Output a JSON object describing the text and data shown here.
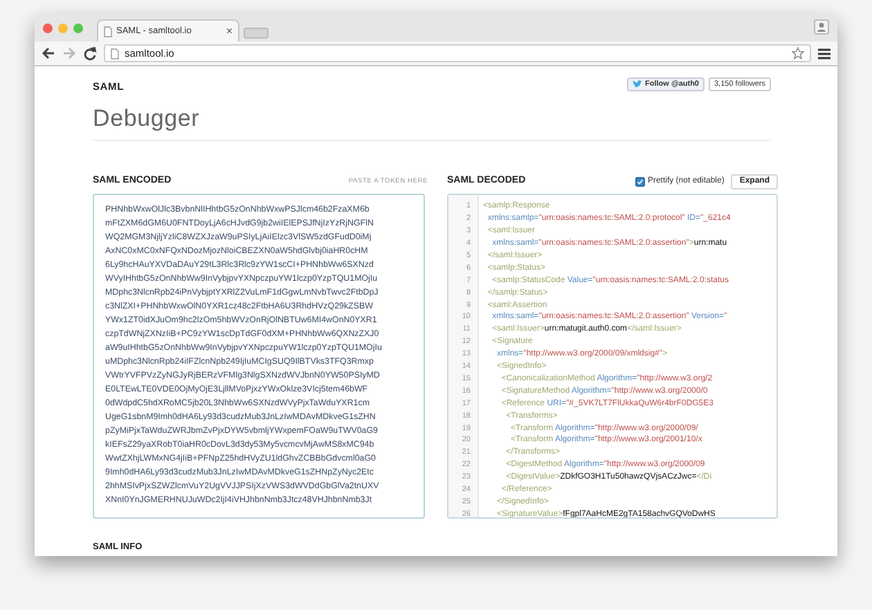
{
  "browser": {
    "tab": {
      "title": "SAML - samltool.io",
      "close": "×"
    },
    "address": "samltool.io"
  },
  "header": {
    "section": "SAML",
    "title": "Debugger",
    "follow_button": "Follow @auth0",
    "followers": "3,150 followers"
  },
  "encoded": {
    "title": "SAML ENCODED",
    "hint": "PASTE A TOKEN HERE",
    "lines": [
      "PHNhbWxwOlJlc3BvbnNlIHhtbG5zOnNhbWxwPSJlcm46b2FzaXM6b",
      "mFtZXM6dGM6U0FNTDoyLjA6cHJvdG9jb2wiIElEPSJfNjIzYzRjNGFlN",
      "WQ2MGM3NjljYzliC8WZXJzaW9uPSIyLjAiIElzc3VlSW5zdGFudD0iMj",
      "AxNC0xMC0xNFQxNDozMjozNloiCBEZXN0aW5hdGlvbj0iaHR0cHM",
      "6Ly9hcHAuYXVDaDAuY29tL3Rlc3Rlc9zYW1scCI+PHNhbWw6SXNzd",
      "WVyIHhtbG5zOnNhbWw9InVybjpvYXNpczpuYW1lczp0YzpTQU1MOjIu",
      "MDphc3NlcnRpb24iPnVybjptYXRlZ2VuLmF1dGgwLmNvbTwvc2FtbDpJ",
      "c3NlZXI+PHNhbWxwOlN0YXR1cz48c2FtbHA6U3RhdHVzQ29kZSBW",
      "YWx1ZT0idXJuOm9hc2lzOm5hbWVzOnRjOlNBTUw6MI4wOnN0YXR1",
      "czpTdWNjZXNzIiB+PC9zYW1scDpTdGF0dXM+PHNhbWw6QXNzZXJ0",
      "aW9uIHhtbG5zOnNhbWw9InVybjpvYXNpczpuYW1lczp0YzpTQU1MOjIu",
      "uMDphc3NlcnRpb24iIFZlcnNpb249IjIuMCIgSUQ9IlBTVks3TFQ3Rmxp",
      "VWtrYVFPVzZyNGJyRjBERzVFMlg3NlgSXNzdWVJbnN0YW50PSIyMD",
      "E0LTEwLTE0VDE0OjMyOjE3LjllMVoPjxzYWxOklze3VIcj5tem46bWF",
      "0dWdpdC5hdXRoMC5jb20L3NhbWw6SXNzdWVyPjxTaWduYXR1cm",
      "UgeG1sbnM9Imh0dHA6Ly93d3cudzMub3JnLzIwMDAvMDkveG1sZHN",
      "pZyMiPjxTaWduZWRJbmZvPjxDYW5vbmljYWxpemFOaW9uTWV0aG9",
      "kIEFsZ29yaXRobT0iaHR0cDovL3d3dy53My5vcmcvMjAwMS8xMC94b",
      "WwtZXhjLWMxNG4jIiB+PFNpZ25hdHVyZU1ldGhvZCBBbGdvcml0aG0",
      "9Imh0dHA6Ly93d3cudzMub3JnLzIwMDAvMDkveG1sZHNpZyNyc2Etc",
      "2hhMSIvPjxSZWZlcmVuY2UgVVJJPSIjXzVWS3dWVDdGbGlVa2tnUXV",
      "XNnI0YnJGMERHNUJuWDc2IjI4iVHJhbnNmb3Jtcz48VHJhbnNmb3Jt"
    ]
  },
  "decoded": {
    "title": "SAML DECODED",
    "prettify": {
      "label": "Prettify (not editable)",
      "checked": true
    },
    "expand_button": "Expand",
    "lines": [
      {
        "number": "1",
        "segments": [
          {
            "kind": "tag",
            "text": "<samlp:Response"
          }
        ]
      },
      {
        "number": "2",
        "segments": [
          {
            "kind": "attr",
            "text": "  xmlns:samlp="
          },
          {
            "kind": "value",
            "text": "\"urn:oasis:names:tc:SAML:2.0:protocol\""
          },
          {
            "kind": "attr",
            "text": " ID="
          },
          {
            "kind": "value",
            "text": "\"_621c4"
          }
        ]
      },
      {
        "number": "3",
        "segments": [
          {
            "kind": "tag",
            "text": "  <saml:Issuer"
          }
        ]
      },
      {
        "number": "4",
        "segments": [
          {
            "kind": "attr",
            "text": "    xmlns:saml="
          },
          {
            "kind": "value",
            "text": "\"urn:oasis:names:tc:SAML:2.0:assertion\""
          },
          {
            "kind": "tag",
            "text": ">"
          },
          {
            "kind": "text",
            "text": "urn:matu"
          }
        ]
      },
      {
        "number": "5",
        "segments": [
          {
            "kind": "tag",
            "text": "  </saml:Issuer>"
          }
        ]
      },
      {
        "number": "6",
        "segments": [
          {
            "kind": "tag",
            "text": "  <samlp:Status>"
          }
        ]
      },
      {
        "number": "7",
        "segments": [
          {
            "kind": "tag",
            "text": "    <samlp:StatusCode"
          },
          {
            "kind": "attr",
            "text": " Value="
          },
          {
            "kind": "value",
            "text": "\"urn:oasis:names:tc:SAML:2.0:status"
          }
        ]
      },
      {
        "number": "8",
        "segments": [
          {
            "kind": "tag",
            "text": "  </samlp:Status>"
          }
        ]
      },
      {
        "number": "9",
        "segments": [
          {
            "kind": "tag",
            "text": "  <saml:Assertion"
          }
        ]
      },
      {
        "number": "10",
        "segments": [
          {
            "kind": "attr",
            "text": "    xmlns:saml="
          },
          {
            "kind": "value",
            "text": "\"urn:oasis:names:tc:SAML:2.0:assertion\""
          },
          {
            "kind": "attr",
            "text": " Version="
          },
          {
            "kind": "value",
            "text": "\""
          }
        ]
      },
      {
        "number": "11",
        "segments": [
          {
            "kind": "tag",
            "text": "    <saml:Issuer>"
          },
          {
            "kind": "text",
            "text": "urn:matugit.auth0.com"
          },
          {
            "kind": "tag",
            "text": "</saml:Issuer>"
          }
        ]
      },
      {
        "number": "12",
        "segments": [
          {
            "kind": "tag",
            "text": "    <Signature"
          }
        ]
      },
      {
        "number": "13",
        "segments": [
          {
            "kind": "attr",
            "text": "      xmlns="
          },
          {
            "kind": "value",
            "text": "\"http://www.w3.org/2000/09/xmldsig#\""
          },
          {
            "kind": "tag",
            "text": ">"
          }
        ]
      },
      {
        "number": "14",
        "segments": [
          {
            "kind": "tag",
            "text": "      <SignedInfo>"
          }
        ]
      },
      {
        "number": "15",
        "segments": [
          {
            "kind": "tag",
            "text": "        <CanonicalizationMethod"
          },
          {
            "kind": "attr",
            "text": " Algorithm="
          },
          {
            "kind": "value",
            "text": "\"http://www.w3.org/2"
          }
        ]
      },
      {
        "number": "16",
        "segments": [
          {
            "kind": "tag",
            "text": "        <SignatureMethod"
          },
          {
            "kind": "attr",
            "text": " Algorithm="
          },
          {
            "kind": "value",
            "text": "\"http://www.w3.org/2000/0"
          }
        ]
      },
      {
        "number": "17",
        "segments": [
          {
            "kind": "tag",
            "text": "        <Reference"
          },
          {
            "kind": "attr",
            "text": " URI="
          },
          {
            "kind": "value",
            "text": "\"#_5VK7LT7FlUkkaQuW6r4brF0DG5E3"
          }
        ]
      },
      {
        "number": "18",
        "segments": [
          {
            "kind": "tag",
            "text": "          <Transforms>"
          }
        ]
      },
      {
        "number": "19",
        "segments": [
          {
            "kind": "tag",
            "text": "            <Transform"
          },
          {
            "kind": "attr",
            "text": " Algorithm="
          },
          {
            "kind": "value",
            "text": "\"http://www.w3.org/2000/09/"
          }
        ]
      },
      {
        "number": "20",
        "segments": [
          {
            "kind": "tag",
            "text": "            <Transform"
          },
          {
            "kind": "attr",
            "text": " Algorithm="
          },
          {
            "kind": "value",
            "text": "\"http://www.w3.org/2001/10/x"
          }
        ]
      },
      {
        "number": "21",
        "segments": [
          {
            "kind": "tag",
            "text": "          </Transforms>"
          }
        ]
      },
      {
        "number": "22",
        "segments": [
          {
            "kind": "tag",
            "text": "          <DigestMethod"
          },
          {
            "kind": "attr",
            "text": " Algorithm="
          },
          {
            "kind": "value",
            "text": "\"http://www.w3.org/2000/09"
          }
        ]
      },
      {
        "number": "23",
        "segments": [
          {
            "kind": "tag",
            "text": "          <DigestValue>"
          },
          {
            "kind": "text",
            "text": "ZDkfGO3H1Tu50hawzQVjsACzJwc="
          },
          {
            "kind": "tag",
            "text": "</Di"
          }
        ]
      },
      {
        "number": "24",
        "segments": [
          {
            "kind": "tag",
            "text": "        </Reference>"
          }
        ]
      },
      {
        "number": "25",
        "segments": [
          {
            "kind": "tag",
            "text": "      </SignedInfo>"
          }
        ]
      },
      {
        "number": "26",
        "segments": [
          {
            "kind": "tag",
            "text": "      <SignatureValue>"
          },
          {
            "kind": "text",
            "text": "fFgpl7AaHcME2gTA158achvGQVoDwHS"
          }
        ]
      }
    ]
  },
  "info": {
    "title": "SAML INFO"
  }
}
